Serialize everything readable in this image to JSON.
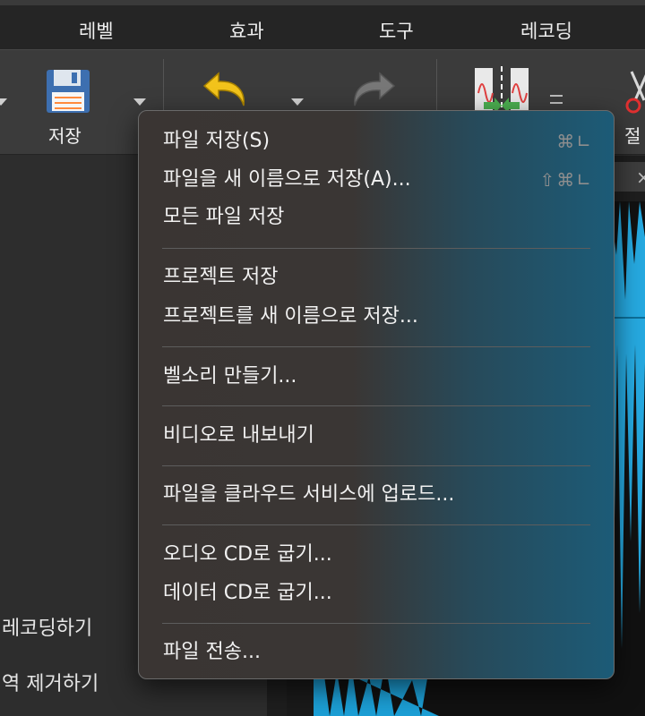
{
  "menubar": {
    "items": [
      "레벨",
      "효과",
      "도구",
      "레코딩"
    ]
  },
  "toolbar": {
    "save_label": "저장",
    "cut_label": "절"
  },
  "left_panel": {
    "items": [
      "레코딩하기",
      "역 제거하기"
    ]
  },
  "editor": {
    "tab_close": "×"
  },
  "context_menu": {
    "sections": [
      [
        {
          "label": "파일 저장(S)",
          "shortcut": "⌘∟"
        },
        {
          "label": "파일을 새 이름으로 저장(A)...",
          "shortcut": "⇧⌘∟"
        },
        {
          "label": "모든 파일 저장",
          "shortcut": ""
        }
      ],
      [
        {
          "label": "프로젝트 저장",
          "shortcut": ""
        },
        {
          "label": "프로젝트를 새 이름으로 저장...",
          "shortcut": ""
        }
      ],
      [
        {
          "label": "벨소리 만들기...",
          "shortcut": ""
        }
      ],
      [
        {
          "label": "비디오로 내보내기",
          "shortcut": ""
        }
      ],
      [
        {
          "label": "파일을 클라우드 서비스에 업로드...",
          "shortcut": ""
        }
      ],
      [
        {
          "label": "오디오 CD로 굽기...",
          "shortcut": ""
        },
        {
          "label": "데이터 CD로 굽기...",
          "shortcut": ""
        }
      ],
      [
        {
          "label": "파일 전송...",
          "shortcut": ""
        }
      ]
    ]
  },
  "colors": {
    "menu_text": "#f1f1f1",
    "shortcut_text": "#8e8e8e",
    "waveform": "#26a9e0",
    "undo_arrow": "#f2c31b"
  }
}
